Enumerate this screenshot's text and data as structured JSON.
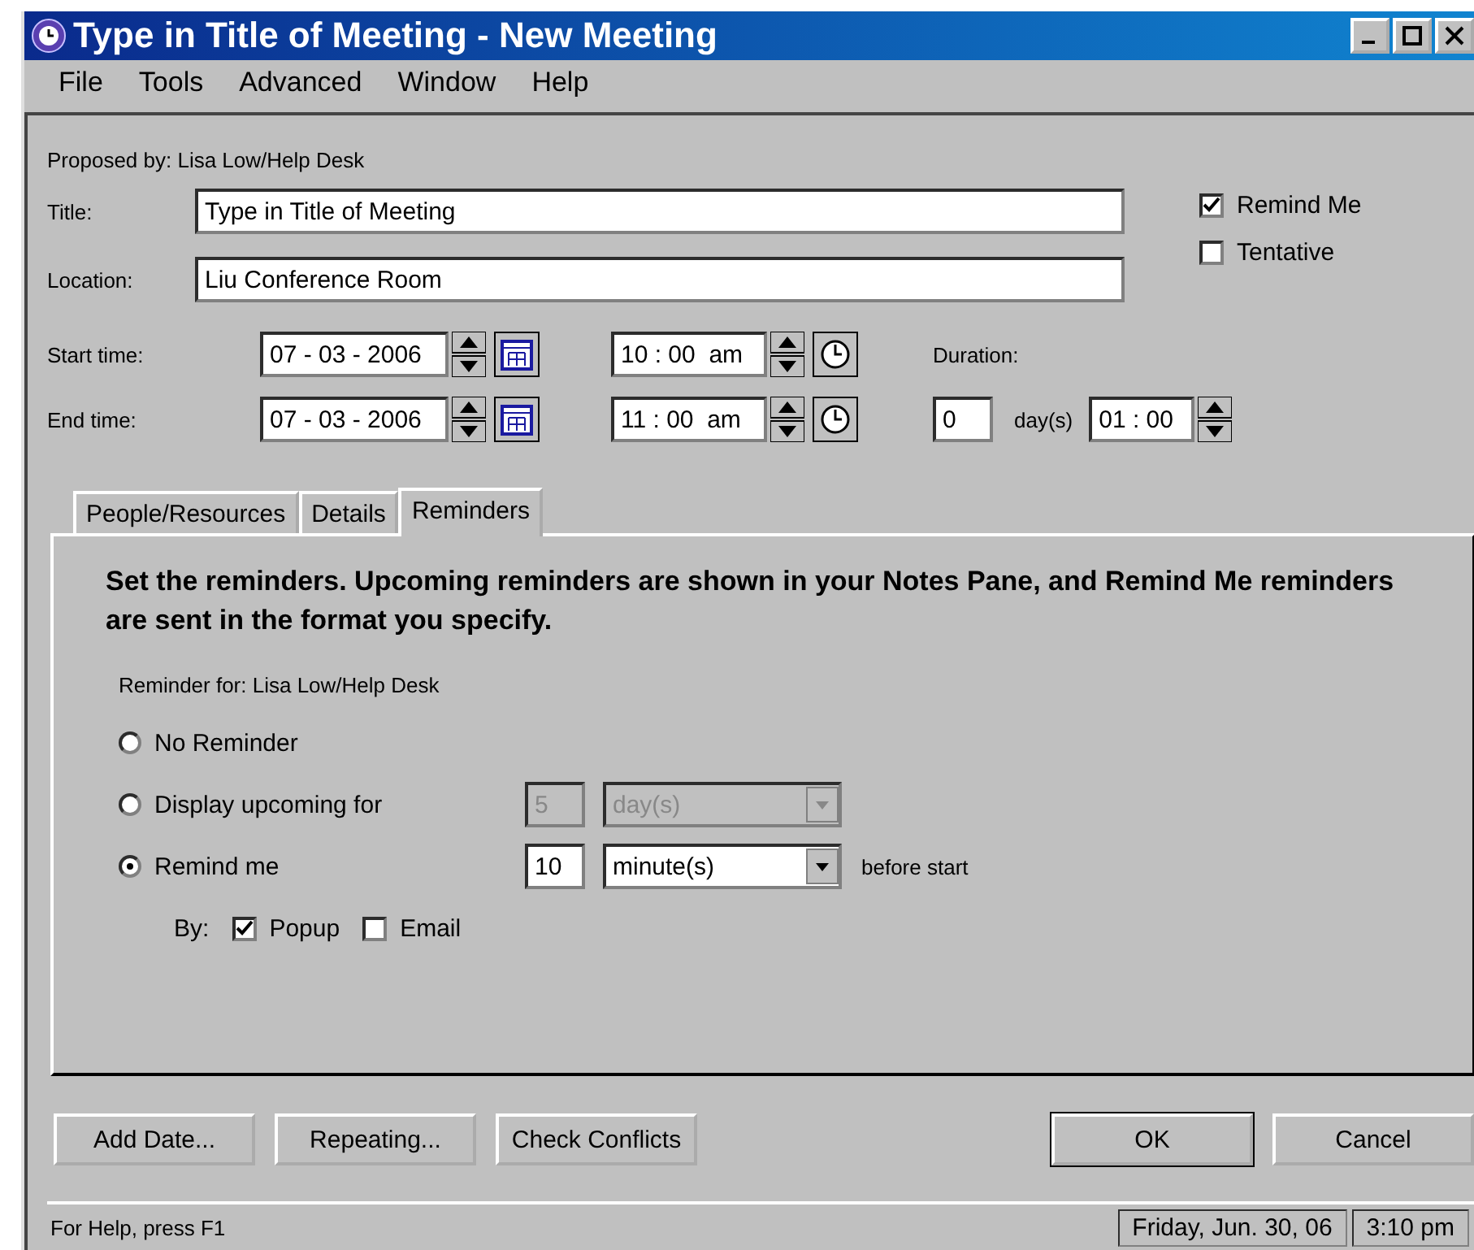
{
  "window": {
    "title": "Type in Title of Meeting - New Meeting"
  },
  "menu": [
    "File",
    "Tools",
    "Advanced",
    "Window",
    "Help"
  ],
  "proposed_by": "Proposed by: Lisa Low/Help Desk",
  "fields": [
    {
      "label": "Title:",
      "value": "Type in Title of Meeting"
    },
    {
      "label": "Location:",
      "value": "Liu Conference Room"
    }
  ],
  "options": [
    {
      "label": "Remind Me",
      "checked": true
    },
    {
      "label": "Tentative",
      "checked": false
    }
  ],
  "times": [
    {
      "label": "Start time:",
      "date": "07 - 03 - 2006",
      "time": "10 : 00  am"
    },
    {
      "label": "End time:",
      "date": "07 - 03 - 2006",
      "time": "11 : 00  am"
    }
  ],
  "duration": {
    "label": "Duration:",
    "days": "0",
    "days_unit": "day(s)",
    "time": "01 : 00"
  },
  "tabs": [
    {
      "label": "People/Resources",
      "selected": false
    },
    {
      "label": "Details",
      "selected": false
    },
    {
      "label": "Reminders",
      "selected": true
    }
  ],
  "reminders": {
    "heading": "Set the reminders. Upcoming reminders are shown in your Notes Pane, and Remind Me reminders are sent in the format you specify.",
    "reminder_for": "Reminder for: Lisa Low/Help Desk",
    "choices": [
      {
        "label": "No Reminder",
        "selected": false
      },
      {
        "label": "Display upcoming for",
        "selected": false,
        "amount": "5",
        "unit": "day(s)",
        "disabled": true
      },
      {
        "label": "Remind me",
        "selected": true,
        "amount": "10",
        "unit": "minute(s)",
        "disabled": false,
        "suffix": "before start"
      }
    ],
    "by": {
      "label": "By:",
      "methods": [
        {
          "label": "Popup",
          "checked": true
        },
        {
          "label": "Email",
          "checked": false
        }
      ]
    }
  },
  "buttons": [
    {
      "label": "Add Date...",
      "default": false
    },
    {
      "label": "Repeating...",
      "default": false
    },
    {
      "label": "Check Conflicts",
      "default": false
    },
    {
      "label": "OK",
      "default": true
    },
    {
      "label": "Cancel",
      "default": false
    }
  ],
  "status_bar": {
    "help": "For Help, press F1",
    "date": "Friday, Jun. 30, 06",
    "time": "3:10 pm"
  }
}
